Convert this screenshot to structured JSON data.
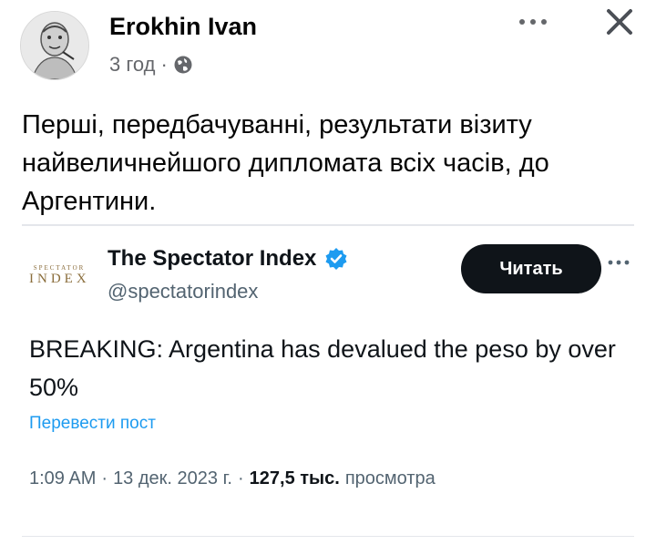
{
  "post": {
    "author_name": "Erokhin Ivan",
    "timestamp": "3 год",
    "separator": "·",
    "privacy_icon": "globe-icon",
    "more_icon": "more-icon",
    "close_icon": "close-icon",
    "text": "Перші, передбачуванні, результати візиту найвеличнейшого дипломата всіх часів, до Аргентини."
  },
  "tweet": {
    "logo": {
      "small": "SPECTATOR",
      "big": "INDEX"
    },
    "name": "The Spectator Index",
    "verified_icon": "verified-badge-icon",
    "handle": "@spectatorindex",
    "follow_label": "Читать",
    "body": "BREAKING: Argentina has devalued the peso by over 50%",
    "translate_label": "Перевести пост",
    "time": "1:09 AM",
    "date": "13 дек. 2023 г.",
    "views_count": "127,5 тыс.",
    "views_label": "просмотра",
    "dot": "·"
  },
  "colors": {
    "link": "#1d9bf0",
    "verified": "#1d9bf0",
    "button_bg": "#0f1419",
    "secondary_text": "#65676b"
  }
}
